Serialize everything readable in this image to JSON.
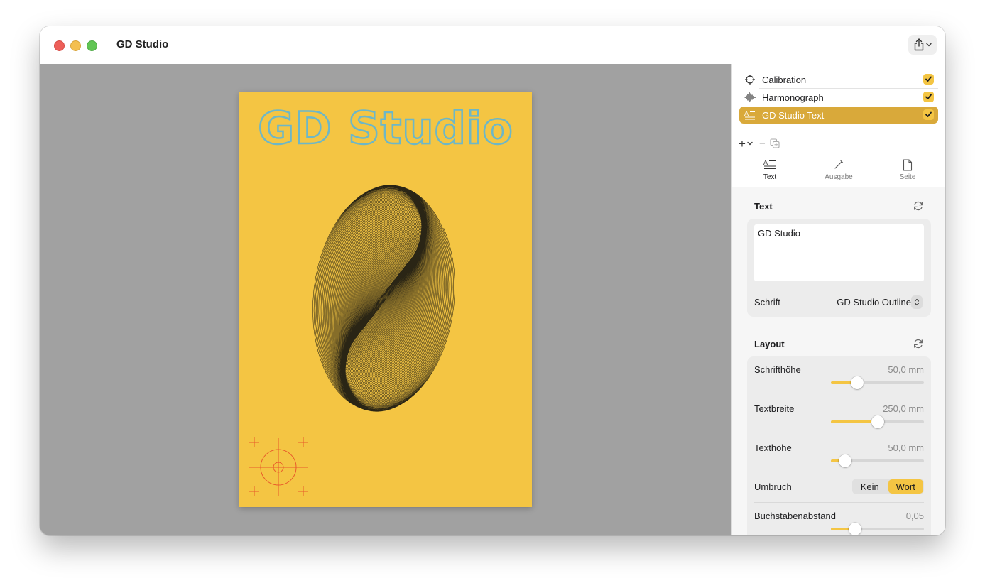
{
  "window": {
    "title": "GD Studio"
  },
  "poster": {
    "title": "GD Studio",
    "colors": {
      "background": "#f4c543",
      "title_outline": "#6db7c7",
      "lines": "#2a2515",
      "calibration": "#e85a2a"
    }
  },
  "layers": [
    {
      "label": "Calibration",
      "icon": "crosshair-icon",
      "checked": true,
      "selected": false
    },
    {
      "label": "Harmonograph",
      "icon": "waveform-icon",
      "checked": true,
      "selected": false
    },
    {
      "label": "GD Studio Text",
      "icon": "text-format-icon",
      "checked": true,
      "selected": true
    }
  ],
  "layer_toolbar": {
    "add": "+",
    "remove": "−"
  },
  "tabs": [
    {
      "label": "Text",
      "icon": "text-format-icon",
      "active": true
    },
    {
      "label": "Ausgabe",
      "icon": "pencil-icon",
      "active": false
    },
    {
      "label": "Seite",
      "icon": "page-icon",
      "active": false
    }
  ],
  "text_section": {
    "title": "Text",
    "text_value": "GD Studio",
    "font_label": "Schrift",
    "font_value": "GD Studio Outline"
  },
  "layout_section": {
    "title": "Layout",
    "font_height": {
      "label": "Schrifthöhe",
      "value": "50,0 mm",
      "fraction": 0.28
    },
    "text_width": {
      "label": "Textbreite",
      "value": "250,0 mm",
      "fraction": 0.5
    },
    "text_height": {
      "label": "Texthöhe",
      "value": "50,0 mm",
      "fraction": 0.15
    },
    "wrap": {
      "label": "Umbruch",
      "options": [
        "Kein",
        "Wort"
      ],
      "selected": "Wort"
    },
    "letter_spacing": {
      "label": "Buchstabenabstand",
      "value": "0,05",
      "fraction": 0.26
    }
  },
  "accent_color": "#f4c543"
}
